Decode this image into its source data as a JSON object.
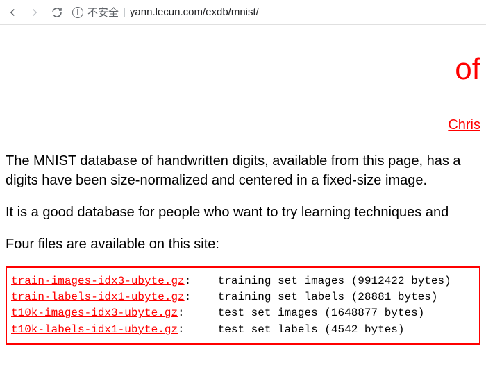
{
  "browser": {
    "security_label": "不安全",
    "url": "yann.lecun.com/exdb/mnist/"
  },
  "page": {
    "heading_fragment": "of",
    "author_fragment": "Chris",
    "para1_line1": "The MNIST database of handwritten digits, available from this page, has a",
    "para1_line2": "digits have been size-normalized and centered in a fixed-size image.",
    "para2": "It is a good database for people who want to try learning techniques and",
    "para3": "Four files are available on this site:",
    "files": [
      {
        "name": "train-images-idx3-ubyte.gz",
        "desc": "training set images (9912422 bytes)"
      },
      {
        "name": "train-labels-idx1-ubyte.gz",
        "desc": "training set labels (28881 bytes)"
      },
      {
        "name": "t10k-images-idx3-ubyte.gz",
        "desc": "test set images (1648877 bytes)"
      },
      {
        "name": "t10k-labels-idx1-ubyte.gz",
        "desc": "test set labels (4542 bytes)"
      }
    ]
  }
}
